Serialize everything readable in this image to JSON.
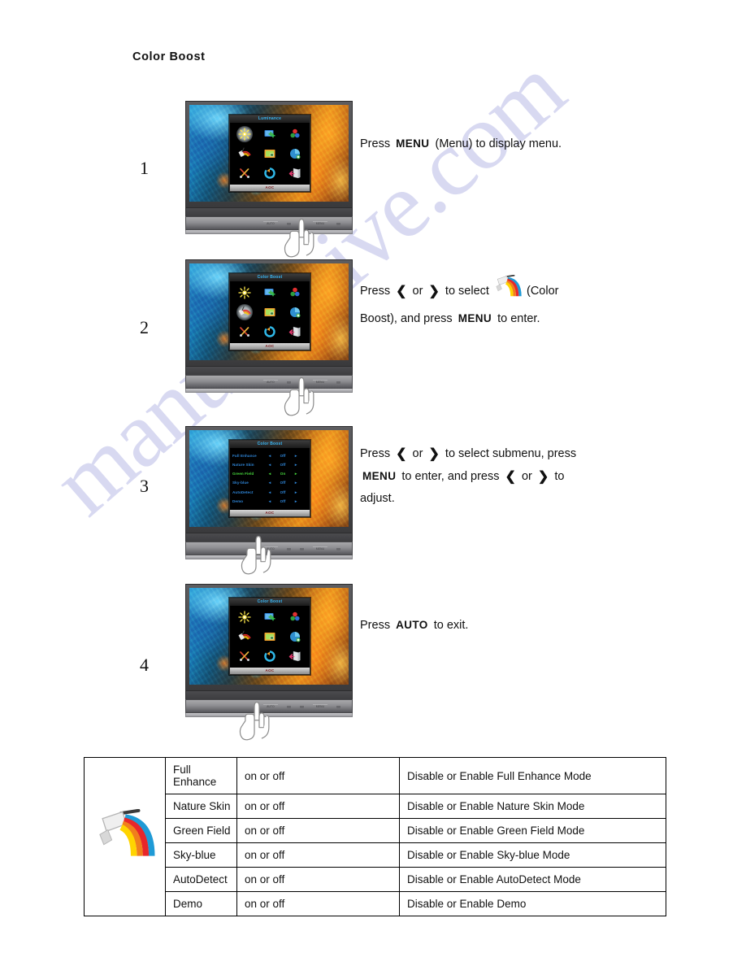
{
  "page": {
    "title": "Color Boost",
    "watermark": "manualshive.com"
  },
  "icons": {
    "color_boost": "color-boost-roller-rainbow-icon",
    "brightness": "brightness-sun-icon",
    "image_setup": "image-setup-icon",
    "color_temp": "color-temperature-icon",
    "picture_boost": "picture-boost-icon",
    "osd_setup": "osd-setup-icon",
    "extra": "extra-tools-icon",
    "reset": "reset-icon",
    "exit": "exit-door-icon"
  },
  "keys": {
    "menu": "MENU",
    "auto": "AUTO",
    "left": "❮",
    "right": "❯"
  },
  "monitor": {
    "brand": "AOC",
    "base_buttons": [
      "AUTO",
      "◄",
      "►",
      "MENU",
      "⏻"
    ]
  },
  "steps": [
    {
      "number": "1",
      "osd_title": "Luminance",
      "osd_mode": "grid",
      "selected_icon": "brightness",
      "text_runs": [
        {
          "type": "text",
          "value": "Press"
        },
        {
          "type": "key",
          "value": "MENU"
        },
        {
          "type": "text",
          "value": "(Menu) to display menu."
        }
      ]
    },
    {
      "number": "2",
      "osd_title": "Color Boost",
      "osd_mode": "grid",
      "selected_icon": "color_boost",
      "text_runs": [
        {
          "type": "text",
          "value": "Press"
        },
        {
          "type": "arrow",
          "value": "❮"
        },
        {
          "type": "text",
          "value": "or"
        },
        {
          "type": "arrow",
          "value": "❯"
        },
        {
          "type": "text",
          "value": "to select"
        },
        {
          "type": "icon",
          "value": "color-boost-roller-rainbow-icon"
        },
        {
          "type": "text",
          "value": "(Color"
        },
        {
          "type": "break",
          "value": ""
        },
        {
          "type": "text",
          "value": "Boost), and press"
        },
        {
          "type": "key",
          "value": "MENU"
        },
        {
          "type": "text",
          "value": "to enter."
        }
      ]
    },
    {
      "number": "3",
      "osd_title": "Color Boost",
      "osd_mode": "list",
      "text_runs": [
        {
          "type": "text",
          "value": "Press"
        },
        {
          "type": "arrow",
          "value": "❮"
        },
        {
          "type": "text",
          "value": "or"
        },
        {
          "type": "arrow",
          "value": "❯"
        },
        {
          "type": "text",
          "value": "to select submenu, press"
        },
        {
          "type": "break",
          "value": ""
        },
        {
          "type": "key",
          "value": "MENU"
        },
        {
          "type": "text",
          "value": "to enter, and press"
        },
        {
          "type": "arrow",
          "value": "❮"
        },
        {
          "type": "text",
          "value": "or"
        },
        {
          "type": "arrow",
          "value": "❯"
        },
        {
          "type": "text",
          "value": "to"
        },
        {
          "type": "break",
          "value": ""
        },
        {
          "type": "text",
          "value": "adjust."
        }
      ]
    },
    {
      "number": "4",
      "osd_title": "Color Boost",
      "osd_mode": "grid",
      "selected_icon": "none",
      "text_runs": [
        {
          "type": "text",
          "value": "Press"
        },
        {
          "type": "key",
          "value": "AUTO"
        },
        {
          "type": "text",
          "value": "to exit."
        }
      ]
    }
  ],
  "osd_submenu": {
    "title": "Color Boost",
    "rows": [
      {
        "name": "Full Enhance",
        "value": "Off",
        "active": false
      },
      {
        "name": "Nature Skin",
        "value": "Off",
        "active": false
      },
      {
        "name": "Green Field",
        "value": "On",
        "active": true
      },
      {
        "name": "Sky-blue",
        "value": "Off",
        "active": false
      },
      {
        "name": "AutoDetect",
        "value": "Off",
        "active": false
      },
      {
        "name": "Demo",
        "value": "Off",
        "active": false
      }
    ]
  },
  "table": {
    "icon_alt": "color-boost-roller-rainbow-icon",
    "rows": [
      {
        "name": "Full Enhance",
        "value": "on or off",
        "desc": "Disable or Enable Full Enhance Mode"
      },
      {
        "name": "Nature Skin",
        "value": "on or off",
        "desc": "Disable or Enable Nature Skin Mode"
      },
      {
        "name": "Green Field",
        "value": "on or off",
        "desc": "Disable or Enable Green Field Mode"
      },
      {
        "name": "Sky-blue",
        "value": "on or off",
        "desc": "Disable or Enable Sky-blue Mode"
      },
      {
        "name": "AutoDetect",
        "value": "on or off",
        "desc": "Disable or Enable AutoDetect Mode"
      },
      {
        "name": "Demo",
        "value": "on or off",
        "desc": "Disable or Enable Demo"
      }
    ]
  },
  "colors": {
    "watermark": "#b9bbe6",
    "osd_text": "#2f86d8",
    "osd_active": "#46d63c",
    "osd_title": "#39b7f5",
    "rainbow": [
      "#e8262a",
      "#f07f1c",
      "#ffd400",
      "#1f9ad6"
    ]
  }
}
